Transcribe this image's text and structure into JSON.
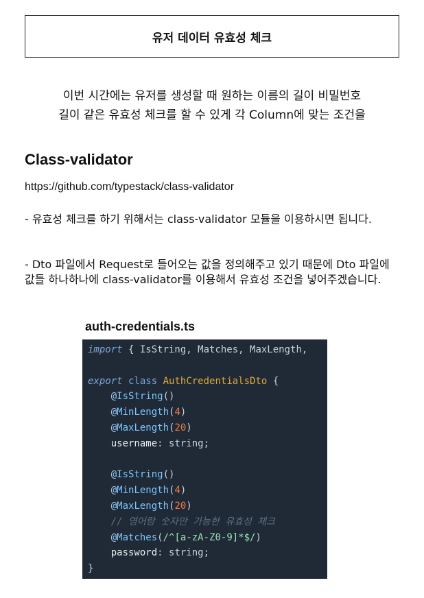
{
  "title": "유저 데이터 유효성 체크",
  "intro": {
    "line1": "이번 시간에는 유저를 생성할 때 원하는 이름의 길이 비밀번호",
    "line2": "길이 같은 유효성 체크를 할 수 있게 각 Column에 맞는 조건을"
  },
  "section_heading": "Class-validator",
  "link": "https://github.com/typestack/class-validator",
  "paragraph1": "- 유효성 체크를 하기 위해서는 class-validator 모듈을 이용하시면 됩니다.",
  "paragraph2": "- Dto 파일에서 Request로 들어오는 값을 정의해주고 있기 때문에 Dto 파일에 값들 하나하나에 class-validator를 이용해서 유효성 조건을 넣어주겠습니다.",
  "code": {
    "filename": "auth-credentials.ts",
    "import_kw": "import",
    "import_rest": " { IsString, Matches, MaxLength,",
    "export_kw": "export",
    "class_kw": "class",
    "class_name": "AuthCredentialsDto",
    "open_brace": " {",
    "close_brace": "}",
    "at": "@",
    "dec_isstring": "IsString",
    "dec_minlength": "MinLength",
    "dec_maxlength": "MaxLength",
    "dec_matches": "Matches",
    "min_value": "4",
    "max_value": "20",
    "username_prop": "username",
    "password_prop": "password",
    "type_string": "string",
    "comment": "// 영어랑 숫자만 가능한 유효성 체크",
    "regex": "/^[a-zA-Z0-9]*$/"
  }
}
